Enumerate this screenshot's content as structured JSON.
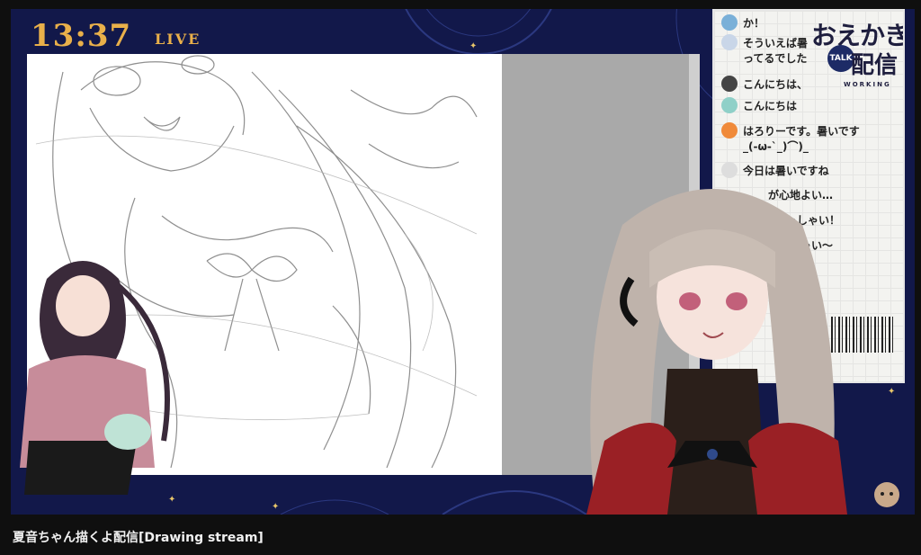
{
  "overlay": {
    "clock": "13:37",
    "live_label": "LIVE"
  },
  "chat": {
    "messages": [
      {
        "text": "か！",
        "color": "#7ab0d8"
      },
      {
        "text": "そういえば暑",
        "color": "#c9d6e8"
      },
      {
        "text": "ってるでした",
        "color": ""
      },
      {
        "text": "こんにちは、",
        "color": "#444444"
      },
      {
        "text": "こんにちは",
        "color": "#8fd0c8"
      },
      {
        "text": "はろりーです。暑いです",
        "color": "#f08a3a"
      },
      {
        "text": "_(-ω-`_)⌒)_",
        "color": ""
      },
      {
        "text": "今日は暑いですね",
        "color": "#dddddd"
      },
      {
        "text": "が心地よい…",
        "color": ""
      },
      {
        "text": "っしゃい！",
        "color": ""
      },
      {
        "text": "ゃい～",
        "color": ""
      }
    ],
    "badge": {
      "title_line1": "おえかき",
      "talk_label": "TALK",
      "title_line2": "配信",
      "working_label": "WORKING"
    }
  },
  "video": {
    "title": "夏音ちゃん描くよ配信[Drawing stream]"
  },
  "colors": {
    "frame_navy": "#12184a",
    "accent_gold": "#e9b04a"
  }
}
